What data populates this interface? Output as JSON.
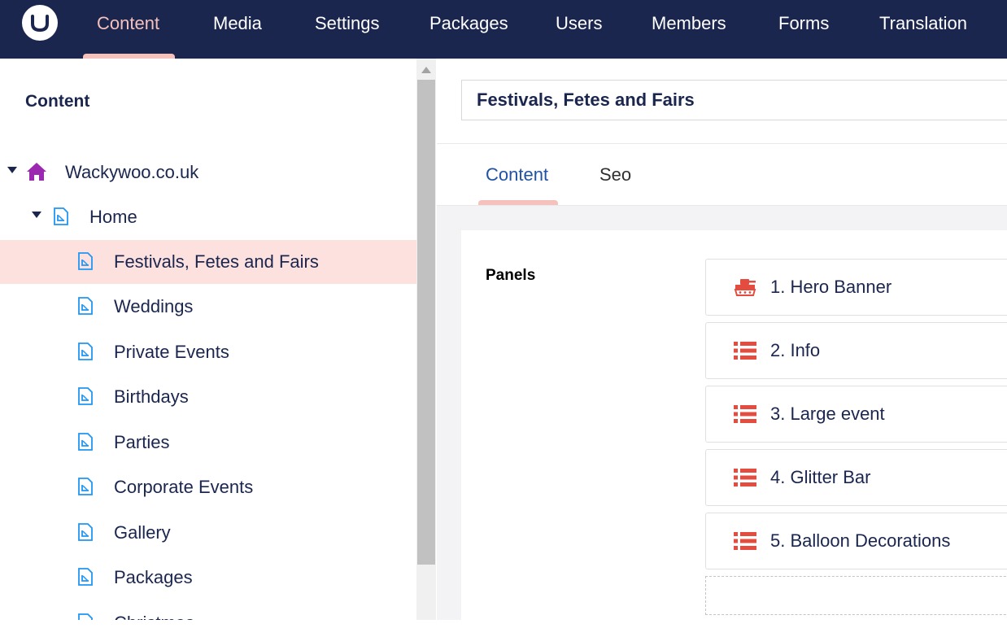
{
  "app": {
    "logo_icon": "umbraco-logo-icon"
  },
  "nav": {
    "items": [
      {
        "label": "Content",
        "active": true
      },
      {
        "label": "Media"
      },
      {
        "label": "Settings"
      },
      {
        "label": "Packages"
      },
      {
        "label": "Users"
      },
      {
        "label": "Members"
      },
      {
        "label": "Forms"
      },
      {
        "label": "Translation"
      }
    ]
  },
  "sidebar": {
    "title": "Content",
    "tree": [
      {
        "label": "Wackywoo.co.uk",
        "icon": "home-icon",
        "expanded": true
      },
      {
        "label": "Home",
        "icon": "document-icon",
        "expanded": true
      },
      {
        "label": "Festivals, Fetes and Fairs",
        "icon": "document-icon",
        "selected": true
      },
      {
        "label": "Weddings",
        "icon": "document-icon"
      },
      {
        "label": "Private Events",
        "icon": "document-icon"
      },
      {
        "label": "Birthdays",
        "icon": "document-icon"
      },
      {
        "label": "Parties",
        "icon": "document-icon"
      },
      {
        "label": "Corporate Events",
        "icon": "document-icon"
      },
      {
        "label": "Gallery",
        "icon": "document-icon"
      },
      {
        "label": "Packages",
        "icon": "document-icon"
      },
      {
        "label": "Christmas",
        "icon": "document-icon"
      }
    ]
  },
  "editor": {
    "name_value": "Festivals, Fetes and Fairs",
    "tabs": [
      {
        "label": "Content",
        "active": true
      },
      {
        "label": "Seo"
      }
    ],
    "property_label": "Panels",
    "blocks": [
      {
        "label": "1. Hero Banner",
        "icon": "tank-icon"
      },
      {
        "label": "2. Info",
        "icon": "list-icon"
      },
      {
        "label": "3. Large event",
        "icon": "list-icon"
      },
      {
        "label": "4. Glitter Bar",
        "icon": "list-icon"
      },
      {
        "label": "5. Balloon Decorations",
        "icon": "list-icon"
      }
    ]
  },
  "colors": {
    "nav_bg": "#1b264f",
    "accent_pink": "#f5c1bc",
    "selected_row": "#fde1de",
    "icon_red": "#e34c3f",
    "home_purple": "#9c27b0",
    "doc_blue": "#2196f3",
    "tab_active": "#2152a3"
  }
}
